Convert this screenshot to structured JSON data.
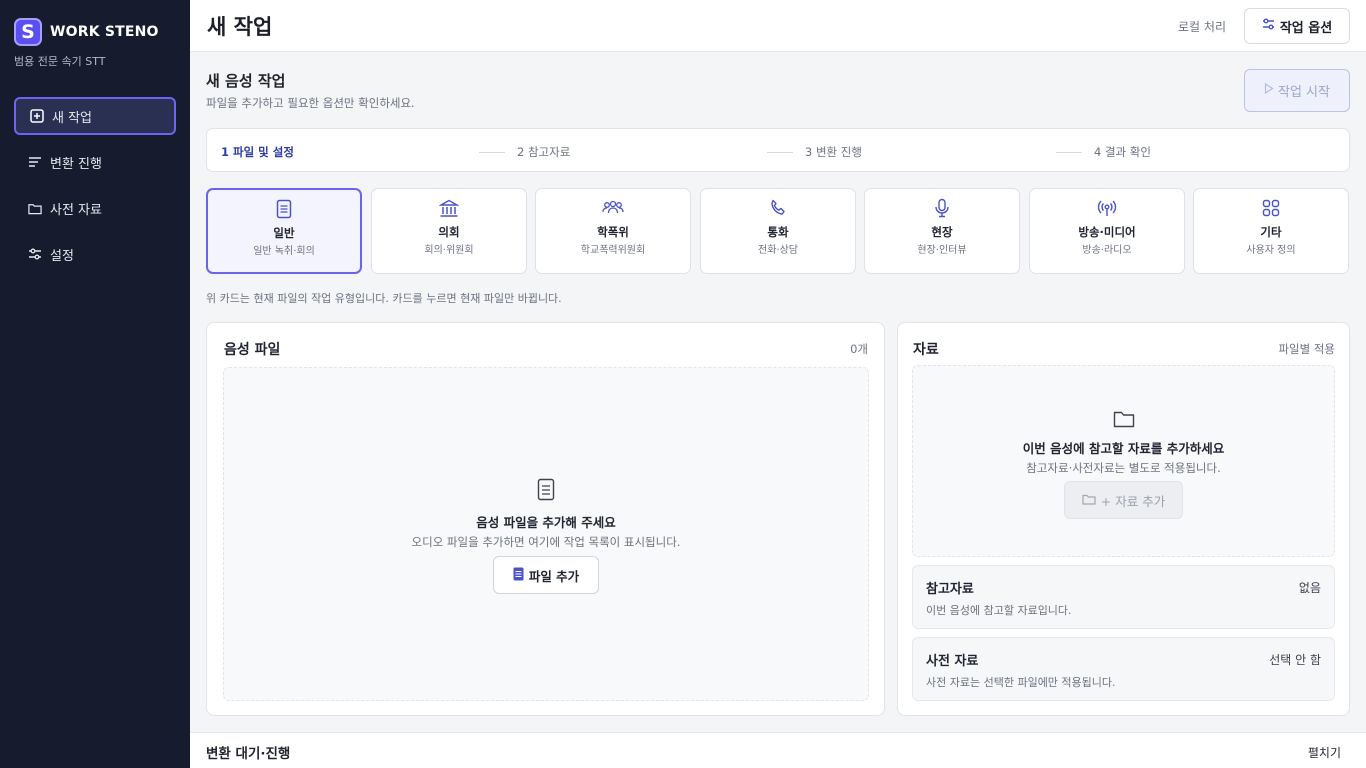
{
  "brand": {
    "logo_letter": "S",
    "name": "WORK STENO",
    "subtitle": "범용 전문 속기 STT"
  },
  "nav": [
    {
      "label": "새 작업",
      "icon": "plus-square-icon",
      "active": true
    },
    {
      "label": "변환 진행",
      "icon": "lines-icon"
    },
    {
      "label": "사전 자료",
      "icon": "folder-icon"
    },
    {
      "label": "설정",
      "icon": "sliders-icon"
    }
  ],
  "header": {
    "title": "새 작업",
    "local_label": "로컬 처리",
    "options_label": "작업 옵션"
  },
  "job": {
    "title": "새 음성 작업",
    "subtitle": "파일을 추가하고 필요한 옵션만 확인하세요.",
    "start_label": "작업 시작"
  },
  "steps": [
    "1  파일 및 설정",
    "2  참고자료",
    "3  변환 진행",
    "4  결과 확인"
  ],
  "cards": [
    {
      "title": "일반",
      "sub": "일반 녹취·회의",
      "icon": "document-icon"
    },
    {
      "title": "의회",
      "sub": "회의·위원회",
      "icon": "building-icon"
    },
    {
      "title": "학폭위",
      "sub": "학교폭력위원회",
      "icon": "group-icon"
    },
    {
      "title": "통화",
      "sub": "전화·상담",
      "icon": "phone-icon"
    },
    {
      "title": "현장",
      "sub": "현장·인터뷰",
      "icon": "microphone-icon"
    },
    {
      "title": "방송·미디어",
      "sub": "방송·라디오",
      "icon": "broadcast-icon"
    },
    {
      "title": "기타",
      "sub": "사용자 정의",
      "icon": "grid-icon"
    }
  ],
  "card_note": "위 카드는 현재 파일의 작업 유형입니다. 카드를 누르면 현재 파일만 바뀝니다.",
  "audio": {
    "title": "음성 파일",
    "count": "0개",
    "empty_title": "음성 파일을 추가해 주세요",
    "empty_sub": "오디오 파일을 추가하면 여기에 작업 목록이 표시됩니다.",
    "add_label": "파일 추가"
  },
  "materials": {
    "title": "자료",
    "apply_label": "파일별 적용",
    "empty_title": "이번 음성에 참고할 자료를 추가하세요",
    "empty_sub": "참고자료·사전자료는 별도로 적용됩니다.",
    "add_label": "+ 자료 추가",
    "reference": {
      "title": "참고자료",
      "value": "없음",
      "sub": "이번 음성에 참고할 자료입니다."
    },
    "dictionary": {
      "title": "사전 자료",
      "value": "선택 안 함",
      "sub": "사전 자료는 선택한 파일에만 적용됩니다."
    }
  },
  "bottom": {
    "title": "변환 대기·진행",
    "expand_label": "펼치기"
  },
  "colors": {
    "accent": "#5b4ff0",
    "sidebar": "#161c2d",
    "active_border": "#6b63e8"
  }
}
